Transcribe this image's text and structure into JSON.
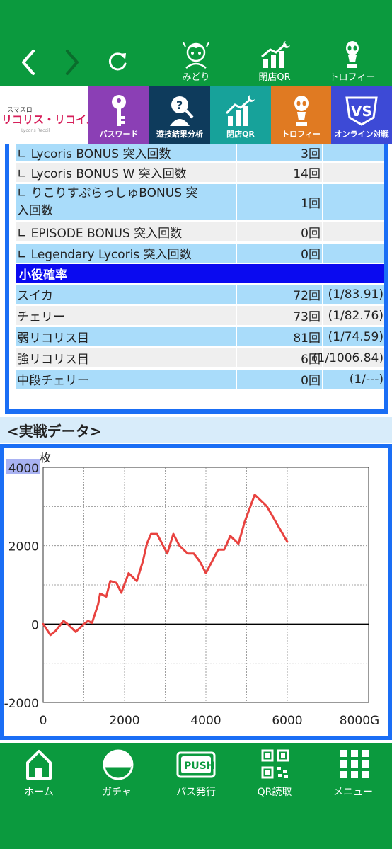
{
  "colors": {
    "green": "#0b9a3e",
    "blue_border": "#1a6ef5",
    "row_blue": "#a9dcfa",
    "section_blue": "#0a0af0",
    "line_red": "#e8423f"
  },
  "top_nav": {
    "back_icon": "chevron-left-icon",
    "forward_icon": "chevron-right-icon",
    "reload_icon": "reload-icon",
    "items": [
      {
        "label": "みどり",
        "icon": "character-icon"
      },
      {
        "label": "閉店QR",
        "icon": "chart-icon"
      },
      {
        "label": "トロフィー",
        "icon": "trophy-icon"
      }
    ]
  },
  "tabs": {
    "logo_title": "リコリス・リコイル",
    "logo_small": "スマスロ",
    "logo_sub": "Lycoris Recoil",
    "items": [
      {
        "label": "パスワード",
        "color": "#8b3fb5",
        "icon": "key-icon"
      },
      {
        "label": "遊技結果分析",
        "color": "#0e3b5c",
        "icon": "analysis-icon"
      },
      {
        "label": "閉店QR",
        "color": "#17a29a",
        "icon": "chart-icon"
      },
      {
        "label": "トロフィー",
        "color": "#e07a22",
        "icon": "trophy-icon"
      },
      {
        "label": "オンライン対戦",
        "color": "#3d4ad6",
        "icon": "vs-icon"
      }
    ]
  },
  "stats": {
    "rows": [
      {
        "name": "∟ Lycoris BONUS 突入回数",
        "count": "3回",
        "prob": ""
      },
      {
        "name": "∟ Lycoris BONUS W 突入回数",
        "count": "14回",
        "prob": ""
      },
      {
        "name": "∟ りこりすぷらっしゅBONUS 突入回数",
        "name_line1": "∟ りこりすぷらっしゅBONUS 突",
        "name_line2": "入回数",
        "count": "1回",
        "prob": ""
      },
      {
        "name": "∟ EPISODE BONUS 突入回数",
        "count": "0回",
        "prob": ""
      },
      {
        "name": "∟ Legendary Lycoris 突入回数",
        "count": "0回",
        "prob": ""
      }
    ],
    "section_title": "小役確率",
    "small_roles": [
      {
        "name": "スイカ",
        "count": "72回",
        "prob": "(1/83.91)"
      },
      {
        "name": "チェリー",
        "count": "73回",
        "prob": "(1/82.76)"
      },
      {
        "name": "弱リコリス目",
        "count": "81回",
        "prob": "(1/74.59)"
      },
      {
        "name": "強リコリス目",
        "count": "6回",
        "prob": "(1/1006.84)"
      },
      {
        "name": "中段チェリー",
        "count": "0回",
        "prob": "(1/---)"
      }
    ]
  },
  "section_header": "<実戦データ>",
  "chart_data": {
    "type": "line",
    "ylabel": "枚",
    "x_unit_suffix": "G",
    "xlim": [
      0,
      8000
    ],
    "ylim": [
      -2000,
      4000
    ],
    "x_ticks": [
      "0",
      "2000",
      "4000",
      "6000",
      "8000G"
    ],
    "y_ticks": [
      "4000",
      "2000",
      "0",
      "-2000"
    ],
    "grid": true,
    "series": [
      {
        "color": "#e8423f",
        "x": [
          0,
          180,
          300,
          500,
          600,
          800,
          1000,
          1100,
          1200,
          1350,
          1400,
          1550,
          1650,
          1800,
          1920,
          2100,
          2300,
          2450,
          2550,
          2650,
          2800,
          2950,
          3050,
          3200,
          3350,
          3550,
          3700,
          3850,
          4000,
          4150,
          4300,
          4450,
          4600,
          4800,
          4950,
          5200,
          5300,
          5500,
          5750,
          6000
        ],
        "y": [
          0,
          -280,
          -180,
          80,
          0,
          -200,
          0,
          80,
          30,
          500,
          780,
          700,
          1100,
          1050,
          800,
          1300,
          1100,
          1600,
          2050,
          2300,
          2300,
          2000,
          1800,
          2300,
          2000,
          1800,
          1800,
          1600,
          1300,
          1600,
          1900,
          1900,
          2250,
          2050,
          2600,
          3300,
          3200,
          3000,
          2550,
          2100
        ]
      }
    ]
  },
  "bottom_nav": [
    {
      "label": "ホーム",
      "icon": "home-icon"
    },
    {
      "label": "ガチャ",
      "icon": "gacha-icon"
    },
    {
      "label": "パス発行",
      "icon": "push-icon",
      "badge": "PUSH"
    },
    {
      "label": "QR読取",
      "icon": "qr-icon"
    },
    {
      "label": "メニュー",
      "icon": "menu-grid-icon"
    }
  ]
}
